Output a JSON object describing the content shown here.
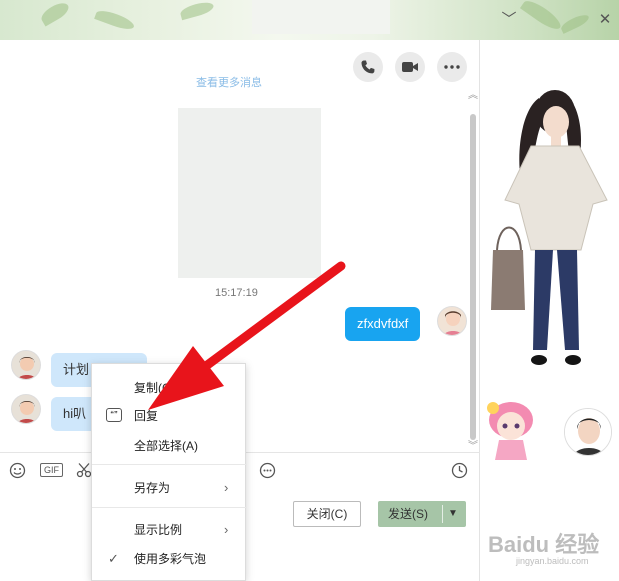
{
  "window": {
    "minimize_glyph": "﹀",
    "close_glyph": "✕"
  },
  "chat": {
    "history_link": "查看更多消息",
    "timestamp": "15:17:19",
    "messages": [
      {
        "side": "right",
        "text": "zfxdvfdxf"
      },
      {
        "side": "left",
        "text": "计划"
      },
      {
        "side": "left",
        "text": "hi叭"
      }
    ]
  },
  "toolbar": {
    "gif_label": "GIF"
  },
  "buttons": {
    "close_label": "关闭(C)",
    "send_label": "发送(S)"
  },
  "context_menu": {
    "items": [
      {
        "label": "复制(C)"
      },
      {
        "label": "回复"
      },
      {
        "label": "全部选择(A)"
      },
      {
        "label": "另存为"
      },
      {
        "label": "显示比例"
      },
      {
        "label": "使用多彩气泡"
      }
    ]
  },
  "watermark": {
    "main": "Baidu 经验",
    "sub": "jingyan.baidu.com"
  },
  "colors": {
    "bubble_right": "#18a4f0",
    "bubble_left": "#cfe7fb",
    "send_button": "#a6c5a7",
    "annotation_arrow": "#e8141b"
  },
  "icons": [
    "phone-icon",
    "video-icon",
    "more-icon",
    "emoji-icon",
    "scissors-icon",
    "folder-icon",
    "image-icon",
    "screenshot-icon",
    "gift-icon",
    "clock-icon",
    "reply-icon",
    "check-icon"
  ]
}
